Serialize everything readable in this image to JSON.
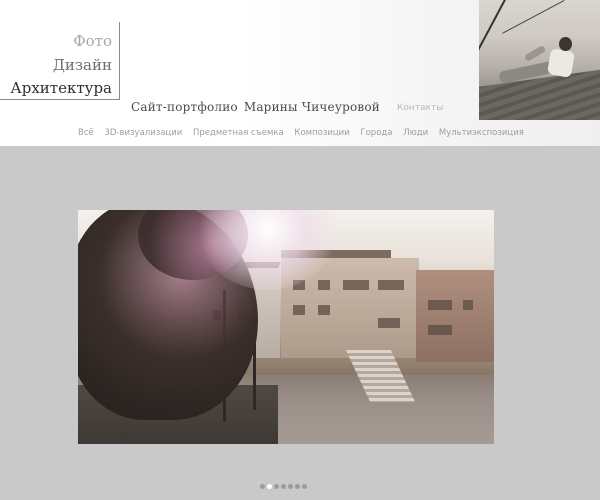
{
  "logo": {
    "line1": "Фото",
    "line2": "Дизайн",
    "line3": "Архитектура"
  },
  "tagline": {
    "part1": "Сайт-портфолио",
    "part2": "Марины Чичеуровой"
  },
  "contacts_label": "Контакты",
  "nav": {
    "items": [
      {
        "label": "Всё"
      },
      {
        "label": "3D-визуализации"
      },
      {
        "label": "Предметная съемка"
      },
      {
        "label": "Композиции"
      },
      {
        "label": "Города"
      },
      {
        "label": "Люди"
      },
      {
        "label": "Мультиэкспозиция"
      }
    ]
  },
  "slider": {
    "dots": 7,
    "active_index": 1
  },
  "colors": {
    "page_bg": "#c9c9c9",
    "header_bg": "#ffffff",
    "nav_text": "#9d9d9d",
    "logo_dark": "#2e2e2e",
    "active_dot": "#ffffff",
    "inactive_dot": "#9b9b9b"
  }
}
